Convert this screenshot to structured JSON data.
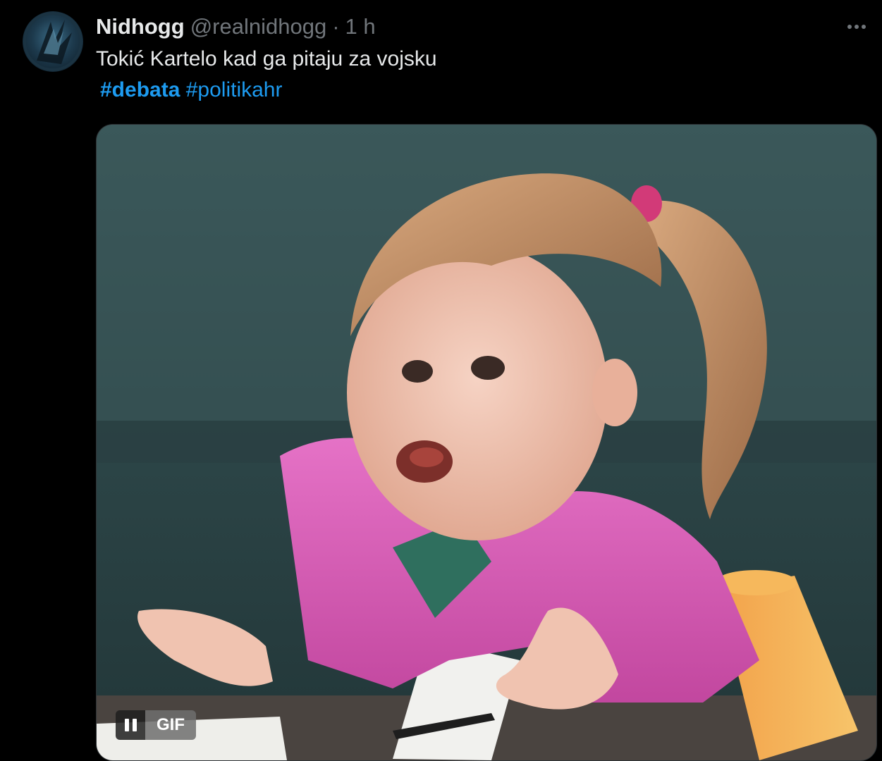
{
  "tweet": {
    "author": {
      "display_name": "Nidhogg",
      "handle": "@realnidhogg",
      "avatar_icon": "avatar-image"
    },
    "separator": "·",
    "time": "1 h",
    "more_icon": "more-options-icon",
    "text": "Tokić Kartelo kad ga pitaju za vojsku",
    "hashtags": [
      {
        "label": "#debata"
      },
      {
        "label": "#politikahr"
      }
    ],
    "media": {
      "type": "GIF",
      "badge_label": "GIF",
      "pause_icon": "pause-icon"
    }
  },
  "colors": {
    "background": "#000000",
    "text_primary": "#e7e9ea",
    "text_secondary": "#71767b",
    "link": "#1d9bf0"
  }
}
